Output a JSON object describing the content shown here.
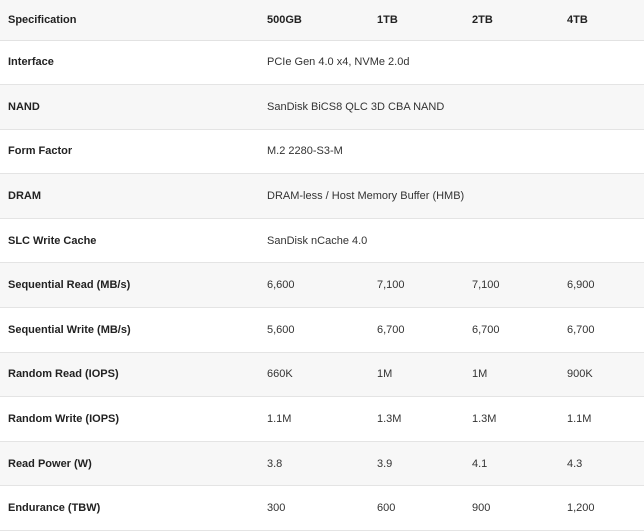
{
  "table": {
    "headers": [
      "Specification",
      "500GB",
      "1TB",
      "2TB",
      "4TB"
    ],
    "rows": [
      {
        "label": "Interface",
        "shared": "PCIe Gen 4.0 x4, NVMe 2.0d"
      },
      {
        "label": "NAND",
        "shared": "SanDisk BiCS8 QLC 3D CBA NAND"
      },
      {
        "label": "Form Factor",
        "shared": "M.2 2280-S3-M"
      },
      {
        "label": "DRAM",
        "shared": "DRAM-less / Host Memory Buffer (HMB)"
      },
      {
        "label": "SLC Write Cache",
        "shared": "SanDisk nCache 4.0"
      },
      {
        "label": "Sequential Read (MB/s)",
        "values": [
          "6,600",
          "7,100",
          "7,100",
          "6,900"
        ]
      },
      {
        "label": "Sequential Write (MB/s)",
        "values": [
          "5,600",
          "6,700",
          "6,700",
          "6,700"
        ]
      },
      {
        "label": "Random Read (IOPS)",
        "values": [
          "660K",
          "1M",
          "1M",
          "900K"
        ]
      },
      {
        "label": "Random Write (IOPS)",
        "values": [
          "1.1M",
          "1.3M",
          "1.3M",
          "1.1M"
        ]
      },
      {
        "label": "Read Power (W)",
        "values": [
          "3.8",
          "3.9",
          "4.1",
          "4.3"
        ]
      },
      {
        "label": "Endurance (TBW)",
        "values": [
          "300",
          "600",
          "900",
          "1,200"
        ]
      }
    ]
  }
}
